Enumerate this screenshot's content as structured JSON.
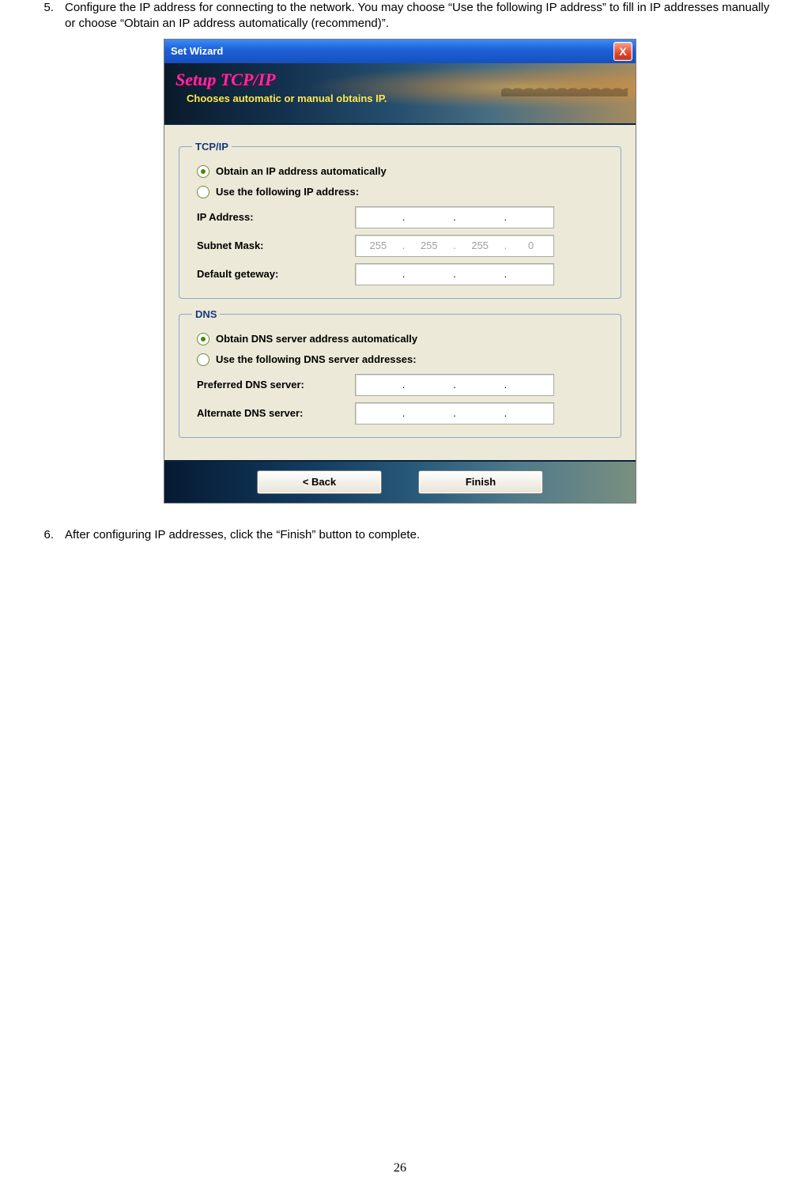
{
  "steps": {
    "five": {
      "num": "5.",
      "text": "Configure the IP address for connecting to the network. You may choose “Use the following IP address” to fill in IP addresses manually or choose “Obtain an IP address automatically (recommend)”."
    },
    "six": {
      "num": "6.",
      "text": "After configuring IP addresses, click the “Finish” button to complete."
    }
  },
  "wizard": {
    "title": "Set Wizard",
    "close": "X",
    "banner_title": "Setup TCP/IP",
    "banner_sub": "Chooses automatic or manual obtains IP.",
    "tcpip": {
      "legend": "TCP/IP",
      "radio_auto": "Obtain an IP address automatically",
      "radio_manual": "Use the following IP address:",
      "ip_label": "IP Address:",
      "ip_value": [
        "",
        "",
        "",
        ""
      ],
      "subnet_label": "Subnet Mask:",
      "subnet_value": [
        "255",
        "255",
        "255",
        "0"
      ],
      "gateway_label": "Default geteway:",
      "gateway_value": [
        "",
        "",
        "",
        ""
      ]
    },
    "dns": {
      "legend": "DNS",
      "radio_auto": "Obtain DNS server address automatically",
      "radio_manual": "Use the following DNS server addresses:",
      "pref_label": "Preferred DNS server:",
      "pref_value": [
        "",
        "",
        "",
        ""
      ],
      "alt_label": "Alternate DNS server:",
      "alt_value": [
        "",
        "",
        "",
        ""
      ]
    },
    "back_btn": "<  Back",
    "finish_btn": "Finish"
  },
  "page_number": "26"
}
